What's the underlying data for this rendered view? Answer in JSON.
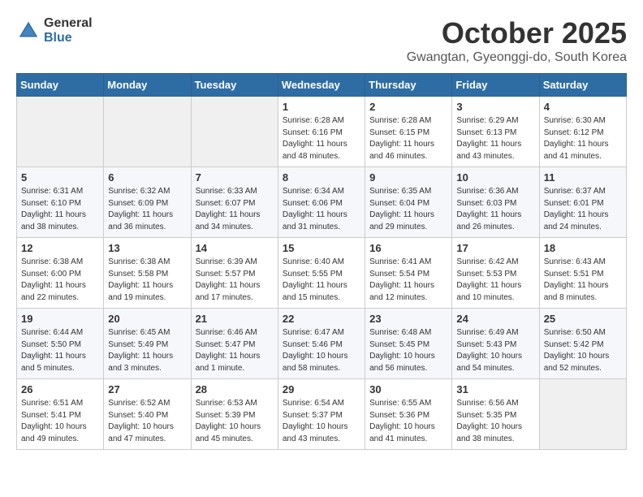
{
  "header": {
    "logo_general": "General",
    "logo_blue": "Blue",
    "month_title": "October 2025",
    "location": "Gwangtan, Gyeonggi-do, South Korea"
  },
  "weekdays": [
    "Sunday",
    "Monday",
    "Tuesday",
    "Wednesday",
    "Thursday",
    "Friday",
    "Saturday"
  ],
  "weeks": [
    [
      {
        "day": "",
        "info": ""
      },
      {
        "day": "",
        "info": ""
      },
      {
        "day": "",
        "info": ""
      },
      {
        "day": "1",
        "info": "Sunrise: 6:28 AM\nSunset: 6:16 PM\nDaylight: 11 hours\nand 48 minutes."
      },
      {
        "day": "2",
        "info": "Sunrise: 6:28 AM\nSunset: 6:15 PM\nDaylight: 11 hours\nand 46 minutes."
      },
      {
        "day": "3",
        "info": "Sunrise: 6:29 AM\nSunset: 6:13 PM\nDaylight: 11 hours\nand 43 minutes."
      },
      {
        "day": "4",
        "info": "Sunrise: 6:30 AM\nSunset: 6:12 PM\nDaylight: 11 hours\nand 41 minutes."
      }
    ],
    [
      {
        "day": "5",
        "info": "Sunrise: 6:31 AM\nSunset: 6:10 PM\nDaylight: 11 hours\nand 38 minutes."
      },
      {
        "day": "6",
        "info": "Sunrise: 6:32 AM\nSunset: 6:09 PM\nDaylight: 11 hours\nand 36 minutes."
      },
      {
        "day": "7",
        "info": "Sunrise: 6:33 AM\nSunset: 6:07 PM\nDaylight: 11 hours\nand 34 minutes."
      },
      {
        "day": "8",
        "info": "Sunrise: 6:34 AM\nSunset: 6:06 PM\nDaylight: 11 hours\nand 31 minutes."
      },
      {
        "day": "9",
        "info": "Sunrise: 6:35 AM\nSunset: 6:04 PM\nDaylight: 11 hours\nand 29 minutes."
      },
      {
        "day": "10",
        "info": "Sunrise: 6:36 AM\nSunset: 6:03 PM\nDaylight: 11 hours\nand 26 minutes."
      },
      {
        "day": "11",
        "info": "Sunrise: 6:37 AM\nSunset: 6:01 PM\nDaylight: 11 hours\nand 24 minutes."
      }
    ],
    [
      {
        "day": "12",
        "info": "Sunrise: 6:38 AM\nSunset: 6:00 PM\nDaylight: 11 hours\nand 22 minutes."
      },
      {
        "day": "13",
        "info": "Sunrise: 6:38 AM\nSunset: 5:58 PM\nDaylight: 11 hours\nand 19 minutes."
      },
      {
        "day": "14",
        "info": "Sunrise: 6:39 AM\nSunset: 5:57 PM\nDaylight: 11 hours\nand 17 minutes."
      },
      {
        "day": "15",
        "info": "Sunrise: 6:40 AM\nSunset: 5:55 PM\nDaylight: 11 hours\nand 15 minutes."
      },
      {
        "day": "16",
        "info": "Sunrise: 6:41 AM\nSunset: 5:54 PM\nDaylight: 11 hours\nand 12 minutes."
      },
      {
        "day": "17",
        "info": "Sunrise: 6:42 AM\nSunset: 5:53 PM\nDaylight: 11 hours\nand 10 minutes."
      },
      {
        "day": "18",
        "info": "Sunrise: 6:43 AM\nSunset: 5:51 PM\nDaylight: 11 hours\nand 8 minutes."
      }
    ],
    [
      {
        "day": "19",
        "info": "Sunrise: 6:44 AM\nSunset: 5:50 PM\nDaylight: 11 hours\nand 5 minutes."
      },
      {
        "day": "20",
        "info": "Sunrise: 6:45 AM\nSunset: 5:49 PM\nDaylight: 11 hours\nand 3 minutes."
      },
      {
        "day": "21",
        "info": "Sunrise: 6:46 AM\nSunset: 5:47 PM\nDaylight: 11 hours\nand 1 minute."
      },
      {
        "day": "22",
        "info": "Sunrise: 6:47 AM\nSunset: 5:46 PM\nDaylight: 10 hours\nand 58 minutes."
      },
      {
        "day": "23",
        "info": "Sunrise: 6:48 AM\nSunset: 5:45 PM\nDaylight: 10 hours\nand 56 minutes."
      },
      {
        "day": "24",
        "info": "Sunrise: 6:49 AM\nSunset: 5:43 PM\nDaylight: 10 hours\nand 54 minutes."
      },
      {
        "day": "25",
        "info": "Sunrise: 6:50 AM\nSunset: 5:42 PM\nDaylight: 10 hours\nand 52 minutes."
      }
    ],
    [
      {
        "day": "26",
        "info": "Sunrise: 6:51 AM\nSunset: 5:41 PM\nDaylight: 10 hours\nand 49 minutes."
      },
      {
        "day": "27",
        "info": "Sunrise: 6:52 AM\nSunset: 5:40 PM\nDaylight: 10 hours\nand 47 minutes."
      },
      {
        "day": "28",
        "info": "Sunrise: 6:53 AM\nSunset: 5:39 PM\nDaylight: 10 hours\nand 45 minutes."
      },
      {
        "day": "29",
        "info": "Sunrise: 6:54 AM\nSunset: 5:37 PM\nDaylight: 10 hours\nand 43 minutes."
      },
      {
        "day": "30",
        "info": "Sunrise: 6:55 AM\nSunset: 5:36 PM\nDaylight: 10 hours\nand 41 minutes."
      },
      {
        "day": "31",
        "info": "Sunrise: 6:56 AM\nSunset: 5:35 PM\nDaylight: 10 hours\nand 38 minutes."
      },
      {
        "day": "",
        "info": ""
      }
    ]
  ]
}
